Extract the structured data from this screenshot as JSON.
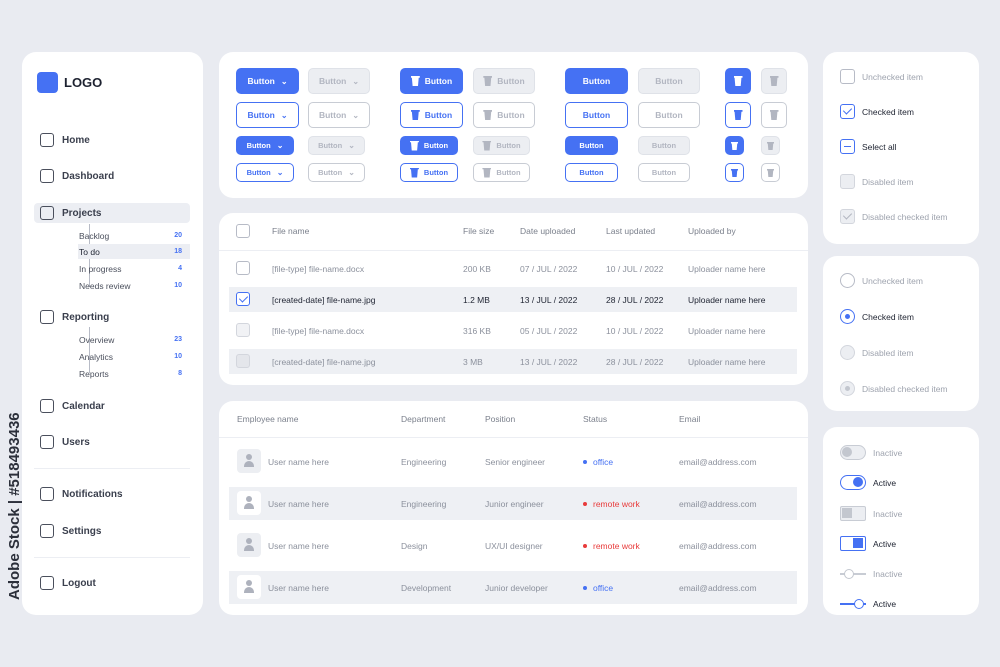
{
  "sidebar": {
    "logo": "LOGO",
    "items": [
      {
        "label": "Home",
        "icon": "home-icon"
      },
      {
        "label": "Dashboard",
        "icon": "grid-icon"
      },
      {
        "label": "Projects",
        "icon": "folder-icon"
      },
      {
        "label": "Reporting",
        "icon": "clipboard-icon"
      },
      {
        "label": "Calendar",
        "icon": "calendar-icon"
      },
      {
        "label": "Users",
        "icon": "user-icon"
      },
      {
        "label": "Notifications",
        "icon": "bell-icon"
      },
      {
        "label": "Settings",
        "icon": "gear-icon"
      },
      {
        "label": "Logout",
        "icon": "logout-icon"
      }
    ],
    "projects_sub": [
      {
        "label": "Backlog",
        "count": "20"
      },
      {
        "label": "To do",
        "count": "18"
      },
      {
        "label": "In progress",
        "count": "4"
      },
      {
        "label": "Needs review",
        "count": "10"
      }
    ],
    "reporting_sub": [
      {
        "label": "Overview",
        "count": "23"
      },
      {
        "label": "Analytics",
        "count": "10"
      },
      {
        "label": "Reports",
        "count": "8"
      }
    ]
  },
  "buttons": {
    "label": "Button"
  },
  "files": {
    "headers": [
      "File name",
      "File size",
      "Date uploaded",
      "Last updated",
      "Uploaded by"
    ],
    "rows": [
      [
        "[file-type] file-name.docx",
        "200 KB",
        "07 / JUL / 2022",
        "10 / JUL / 2022",
        "Uploader name here"
      ],
      [
        "[created-date] file-name.jpg",
        "1.2 MB",
        "13 / JUL / 2022",
        "28 / JUL / 2022",
        "Uploader name here"
      ],
      [
        "[file-type] file-name.docx",
        "316 KB",
        "05 / JUL / 2022",
        "10 / JUL / 2022",
        "Uploader name here"
      ],
      [
        "[created-date] file-name.jpg",
        "3 MB",
        "13 / JUL / 2022",
        "28 / JUL / 2022",
        "Uploader name here"
      ]
    ]
  },
  "employees": {
    "headers": [
      "Employee name",
      "Department",
      "Position",
      "Status",
      "Email"
    ],
    "rows": [
      [
        "User name here",
        "Engineering",
        "Senior engineer",
        "office",
        "email@address.com"
      ],
      [
        "User name here",
        "Engineering",
        "Junior engineer",
        "remote work",
        "email@address.com"
      ],
      [
        "User name here",
        "Design",
        "UX/UI designer",
        "remote work",
        "email@address.com"
      ],
      [
        "User name here",
        "Development",
        "Junior developer",
        "office",
        "email@address.com"
      ]
    ]
  },
  "checkboxes": [
    "Unchecked item",
    "Checked item",
    "Select all",
    "Disabled item",
    "Disabled checked item"
  ],
  "radios": [
    "Unchecked item",
    "Checked item",
    "Disabled item",
    "Disabled checked item"
  ],
  "toggles": [
    "Inactive",
    "Active",
    "Inactive",
    "Active",
    "Inactive",
    "Active"
  ],
  "watermark": "Adobe Stock | #518493436",
  "colors": {
    "accent": "#4571f3",
    "status_office": "#4571f3",
    "status_remote": "#e83b3b"
  }
}
